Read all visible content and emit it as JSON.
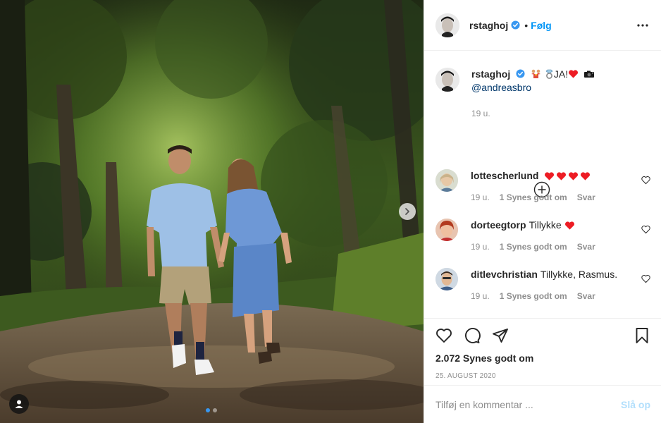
{
  "post": {
    "username": "rstaghoj",
    "follow_sep": "•",
    "follow_label": "Følg",
    "more_icon": "more-horizontal-icon"
  },
  "caption": {
    "username": "rstaghoj",
    "text": "JA!",
    "mention": "@andreasbro",
    "time": "19 u."
  },
  "comments": [
    {
      "username": "lottescherlund",
      "text": "",
      "hearts": 4,
      "time": "19 u.",
      "likes": "1 Synes godt om",
      "reply": "Svar"
    },
    {
      "username": "dorteegtorp",
      "text": "Tillykke",
      "hearts": 1,
      "time": "19 u.",
      "likes": "1 Synes godt om",
      "reply": "Svar"
    },
    {
      "username": "ditlevchristian",
      "text": "Tillykke, Rasmus.",
      "hearts": 0,
      "time": "19 u.",
      "likes": "1 Synes godt om",
      "reply": "Svar"
    }
  ],
  "stats": {
    "likes": "2.072 Synes godt om",
    "date": "25. AUGUST 2020"
  },
  "add_comment": {
    "placeholder": "Tilføj en kommentar ...",
    "post_label": "Slå op"
  },
  "carousel": {
    "current": 1,
    "total": 2
  },
  "colors": {
    "accent": "#0095f6",
    "verified": "#3897f0",
    "link": "#00376b",
    "muted": "#8e8e8e",
    "heart": "#ed1c24"
  }
}
